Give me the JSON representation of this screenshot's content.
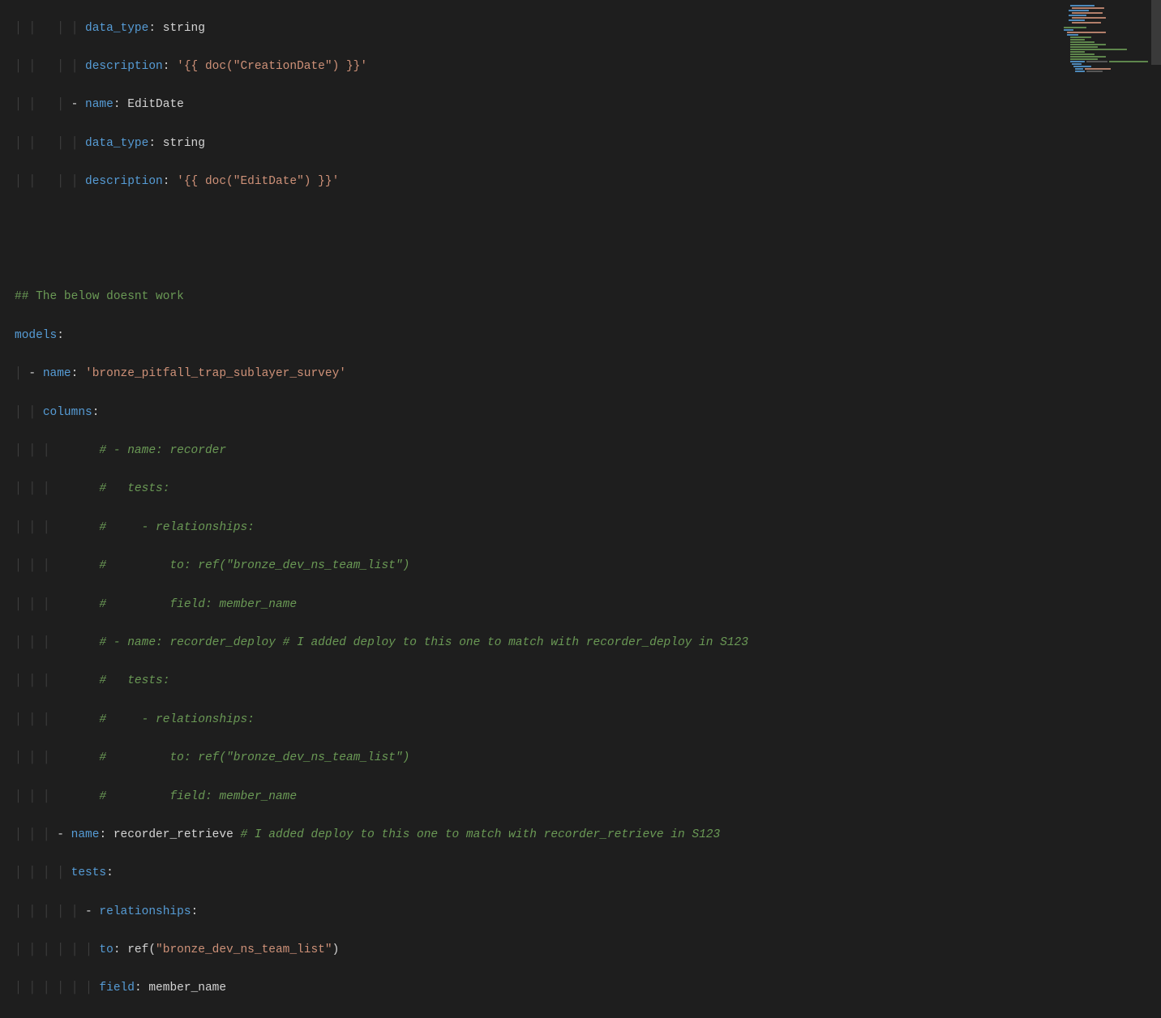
{
  "code": {
    "l1": {
      "indent": "        ",
      "key": "data_type",
      "val": "string"
    },
    "l2": {
      "indent": "        ",
      "key": "description",
      "val": "'{{ doc(\"CreationDate\") }}'"
    },
    "l3": {
      "indent": "      ",
      "key": "name",
      "val": "EditDate"
    },
    "l4": {
      "indent": "        ",
      "key": "data_type",
      "val": "string"
    },
    "l5": {
      "indent": "        ",
      "key": "description",
      "val": "'{{ doc(\"EditDate\") }}'"
    },
    "comment_header": "## The below doesnt work",
    "models_key": "models",
    "model_name_key": "name",
    "model_name_val": "'bronze_pitfall_trap_sublayer_survey'",
    "columns_key": "columns",
    "cc1": "      # - name: recorder",
    "cc2": "      #   tests:",
    "cc3": "      #     - relationships:",
    "cc4": "      #         to: ref(\"bronze_dev_ns_team_list\")",
    "cc5": "      #         field: member_name",
    "cc6": "      # - name: recorder_deploy # I added deploy to this one to match with recorder_deploy in S123",
    "cc7": "      #   tests:",
    "cc8": "      #     - relationships:",
    "cc9": "      #         to: ref(\"bronze_dev_ns_team_list\")",
    "cc10": "      #         field: member_name",
    "col_name_key": "name",
    "col_name_val": "recorder_retrieve",
    "col_name_comment": " # I added deploy to this one to match with recorder_retrieve in S123",
    "tests_key": "tests",
    "rel_key": "relationships",
    "to_key": "to",
    "to_val": "ref(\"bronze_dev_ns_team_list\")",
    "field_key": "field",
    "field_val": "member_name"
  }
}
